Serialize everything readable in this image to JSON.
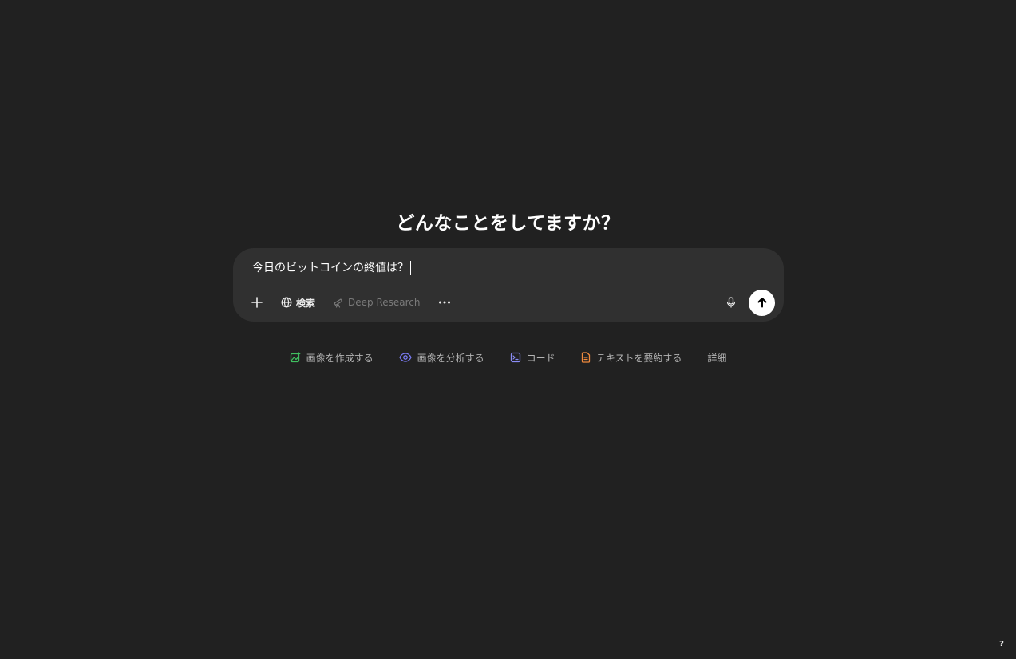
{
  "main": {
    "headline": "どんなことをしてますか？"
  },
  "composer": {
    "input_value": "今日のビットコインの終値は？",
    "tools": {
      "search_label": "検索",
      "deep_research_label": "Deep Research"
    }
  },
  "suggestions": [
    {
      "label": "画像を作成する",
      "icon": "image-create-icon",
      "color": "#3fbf5f"
    },
    {
      "label": "画像を分析する",
      "icon": "eye-icon",
      "color": "#7b7cf6"
    },
    {
      "label": "コード",
      "icon": "terminal-icon",
      "color": "#8a8cf6"
    },
    {
      "label": "テキストを要約する",
      "icon": "document-icon",
      "color": "#f08a3c"
    },
    {
      "label": "詳細",
      "icon": null,
      "color": null
    }
  ],
  "footer": {
    "help_label": "?"
  }
}
